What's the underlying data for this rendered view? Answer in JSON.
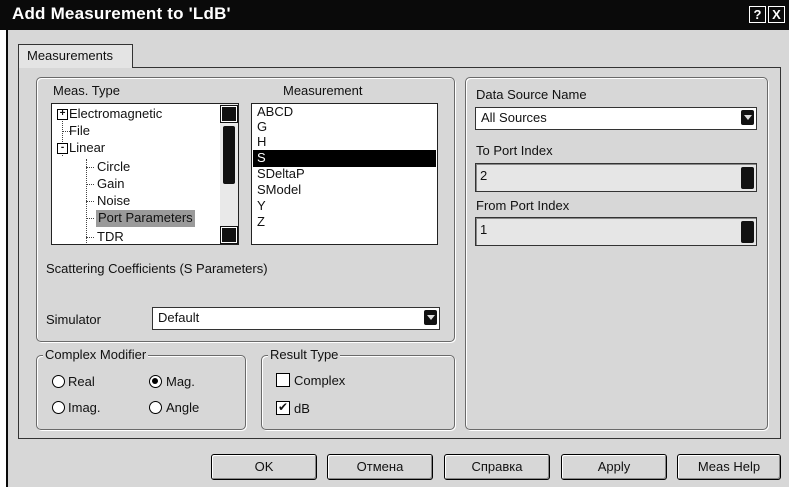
{
  "window": {
    "title": "Add Measurement to 'LdB'",
    "help_glyph": "?",
    "close_glyph": "X"
  },
  "tabs": [
    {
      "label": "Measurements",
      "active": true
    }
  ],
  "meas_type": {
    "header": "Meas. Type",
    "tree": [
      {
        "label": "Electromagnetic",
        "expander": "+",
        "level": 0
      },
      {
        "label": "File",
        "expander": "",
        "level": 0
      },
      {
        "label": "Linear",
        "expander": "-",
        "level": 0
      },
      {
        "label": "Circle",
        "expander": "",
        "level": 1
      },
      {
        "label": "Gain",
        "expander": "",
        "level": 1
      },
      {
        "label": "Noise",
        "expander": "",
        "level": 1
      },
      {
        "label": "Port Parameters",
        "expander": "",
        "level": 1,
        "selected": true
      },
      {
        "label": "TDR",
        "expander": "",
        "level": 1
      }
    ]
  },
  "measurement": {
    "header": "Measurement",
    "items": [
      "ABCD",
      "G",
      "H",
      "S",
      "SDeltaP",
      "SModel",
      "Y",
      "Z"
    ],
    "selected": "S"
  },
  "description": "Scattering Coefficients (S Parameters)",
  "simulator": {
    "label": "Simulator",
    "value": "Default"
  },
  "complex_modifier": {
    "legend": "Complex Modifier",
    "options": [
      {
        "label": "Real",
        "checked": false
      },
      {
        "label": "Mag.",
        "checked": true
      },
      {
        "label": "Imag.",
        "checked": false
      },
      {
        "label": "Angle",
        "checked": false
      }
    ]
  },
  "result_type": {
    "legend": "Result Type",
    "complex": {
      "label": "Complex",
      "checked": false
    },
    "db": {
      "label": "dB",
      "checked": true,
      "glyph": "✔"
    }
  },
  "data_source": {
    "label": "Data Source Name",
    "value": "All Sources"
  },
  "to_port": {
    "label": "To Port Index",
    "value": "2"
  },
  "from_port": {
    "label": "From Port Index",
    "value": "1"
  },
  "buttons": {
    "ok": "OK",
    "cancel": "Отмена",
    "help": "Справка",
    "apply": "Apply",
    "meas_help": "Meas Help"
  },
  "colors": {
    "title_bar": "#0a0a0a",
    "dialog_bg": "#d7d7d7",
    "selection": "#000000",
    "tree_selection": "#9a9a9a"
  }
}
